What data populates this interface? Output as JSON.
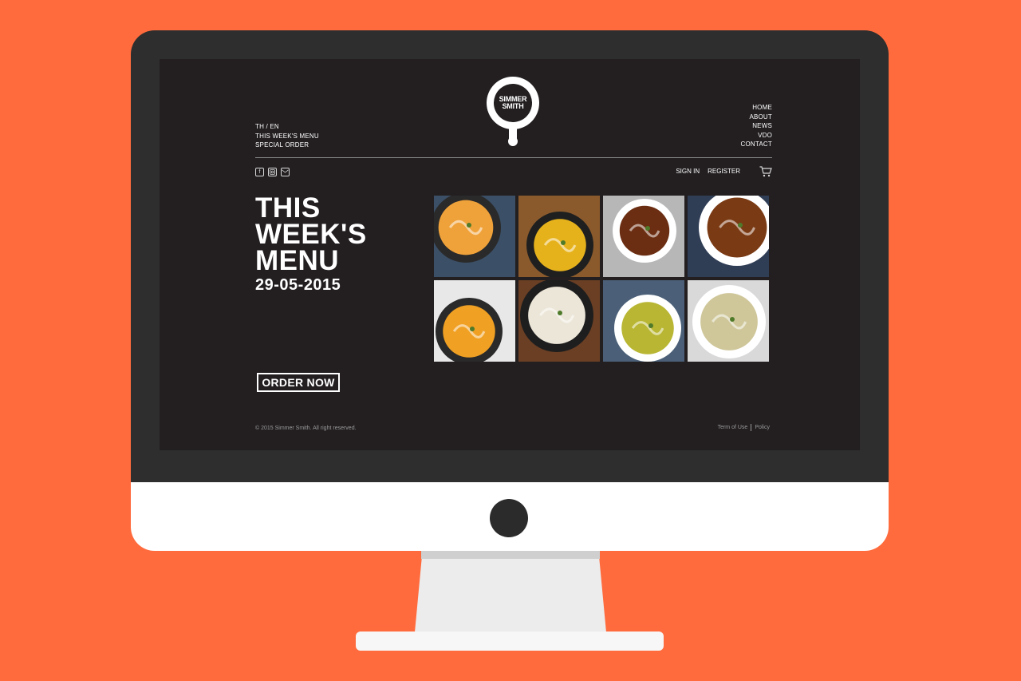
{
  "colors": {
    "background": "#ff6b3d",
    "screen": "#231f20",
    "bezel": "#2e2e2e",
    "text": "#ffffff",
    "muted": "#9a9a9a"
  },
  "logo": {
    "line1": "SIMMER",
    "line2": "SMITH"
  },
  "nav_left": [
    "TH / EN",
    "THIS WEEK'S MENU",
    "SPECIAL ORDER"
  ],
  "nav_right": [
    "HOME",
    "ABOUT",
    "NEWS",
    "VDO",
    "CONTACT"
  ],
  "social_icons": [
    "facebook-icon",
    "instagram-icon",
    "mail-icon"
  ],
  "auth": {
    "sign_in": "SIGN IN",
    "register": "REGISTER"
  },
  "cart_icon": "cart-icon",
  "hero": {
    "line1": "THIS",
    "line2": "WEEK'S",
    "line3": "MENU",
    "date": "29-05-2015",
    "order_label": "ORDER NOW"
  },
  "gallery": [
    {
      "soup": "#f0a23a",
      "bowl": "#2a2a2a",
      "table": "#3b4f66"
    },
    {
      "soup": "#e6b21c",
      "bowl": "#1f1f1f",
      "table": "#8a5a2c"
    },
    {
      "soup": "#6b2e12",
      "bowl": "#ffffff",
      "table": "#b7b7b7"
    },
    {
      "soup": "#7a3a14",
      "bowl": "#ffffff",
      "table": "#2f3d55"
    },
    {
      "soup": "#f0a023",
      "bowl": "#2a2a2a",
      "table": "#e8e8e8"
    },
    {
      "soup": "#ece6d8",
      "bowl": "#1e1e1e",
      "table": "#6a3f24"
    },
    {
      "soup": "#b8b632",
      "bowl": "#ffffff",
      "table": "#4b6078"
    },
    {
      "soup": "#cfc79a",
      "bowl": "#ffffff",
      "table": "#d9d9d9"
    }
  ],
  "footer": {
    "copyright": "© 2015 Simmer Smith. All right reserved.",
    "terms": "Term of Use",
    "policy": "Policy"
  }
}
